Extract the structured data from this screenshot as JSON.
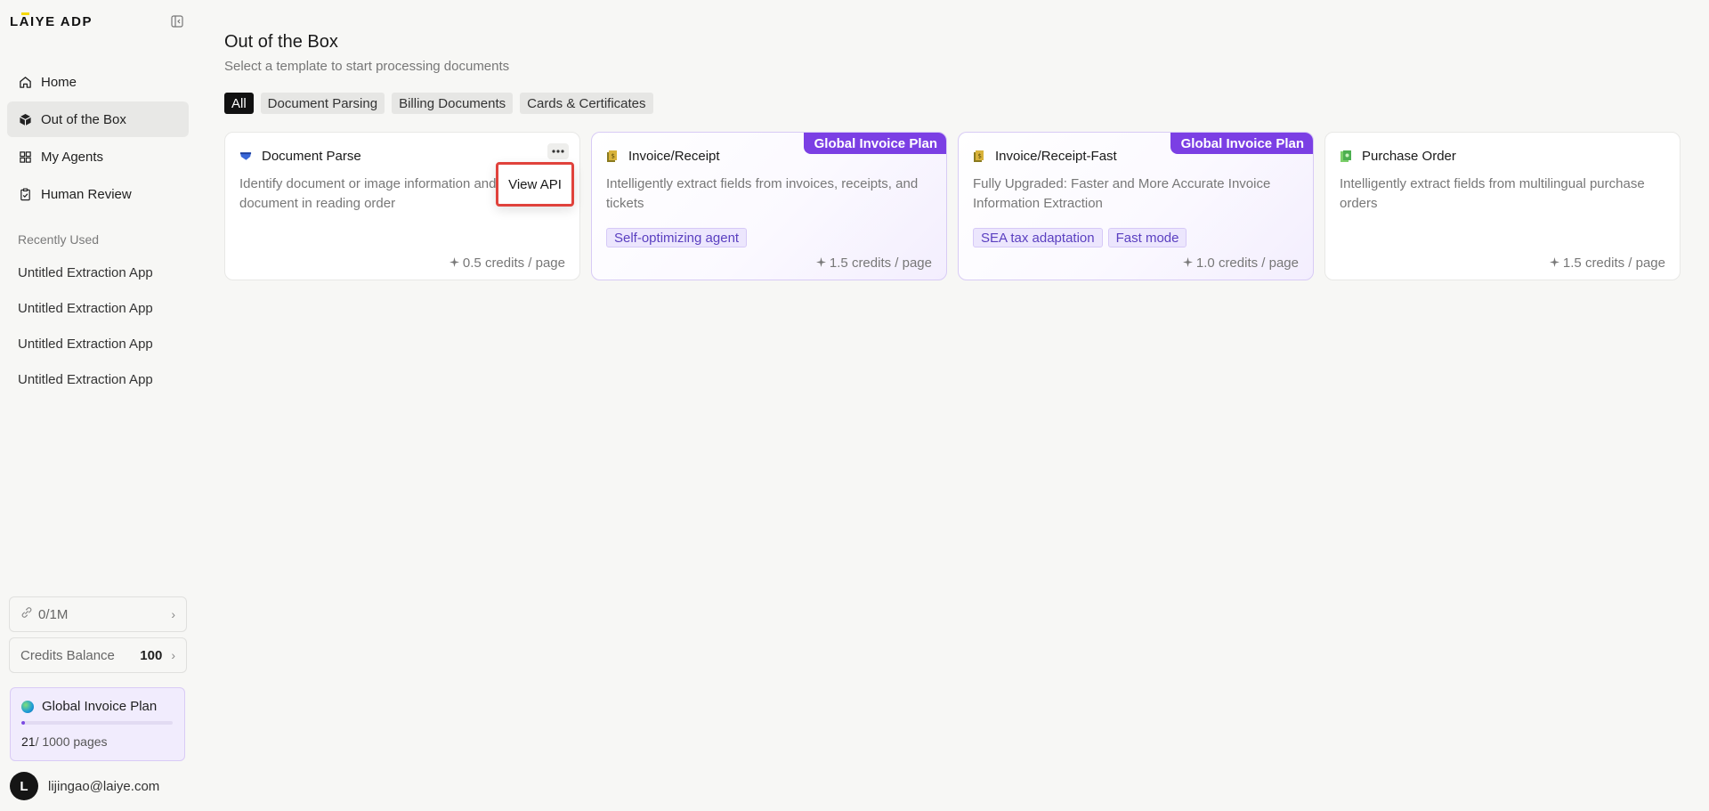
{
  "app": {
    "logo_text": "LAIYE ADP"
  },
  "sidebar": {
    "nav": [
      {
        "label": "Home",
        "icon": "home-icon"
      },
      {
        "label": "Out of the Box",
        "icon": "cube-icon",
        "active": true
      },
      {
        "label": "My Agents",
        "icon": "grid-icon"
      },
      {
        "label": "Human Review",
        "icon": "clipboard-check-icon"
      }
    ],
    "recent_title": "Recently Used",
    "recent": [
      "Untitled Extraction App",
      "Untitled Extraction App",
      "Untitled Extraction App",
      "Untitled Extraction App"
    ],
    "usage_label": "0/1M",
    "credits_label": "Credits Balance",
    "credits_value": "100",
    "plan": {
      "name": "Global Invoice Plan",
      "used": "21",
      "total_text": "/ 1000 pages",
      "progress_fraction": 0.021
    },
    "user": {
      "initial": "L",
      "email": "lijingao@laiye.com"
    }
  },
  "main": {
    "title": "Out of the Box",
    "subtitle": "Select a template to start processing documents",
    "filters": [
      {
        "label": "All",
        "active": true
      },
      {
        "label": "Document Parsing"
      },
      {
        "label": "Billing Documents"
      },
      {
        "label": "Cards & Certificates"
      }
    ],
    "cards": [
      {
        "title": "Document Parse",
        "description": "Identify document or image information and output the document in reading order",
        "tags": [],
        "credits": "0.5 credits / page",
        "ribbon": "",
        "icon": "document-parse-icon"
      },
      {
        "title": "Invoice/Receipt",
        "description": "Intelligently extract fields from invoices, receipts, and tickets",
        "tags": [
          "Self-optimizing agent"
        ],
        "credits": "1.5 credits / page",
        "ribbon": "Global Invoice Plan",
        "icon": "invoice-icon"
      },
      {
        "title": "Invoice/Receipt-Fast",
        "description": "Fully Upgraded: Faster and More Accurate Invoice Information Extraction",
        "tags": [
          "SEA tax adaptation",
          "Fast mode"
        ],
        "credits": "1.0 credits / page",
        "ribbon": "Global Invoice Plan",
        "icon": "invoice-fast-icon"
      },
      {
        "title": "Purchase Order",
        "description": "Intelligently extract fields from multilingual purchase orders",
        "tags": [],
        "credits": "1.5 credits / page",
        "ribbon": "",
        "icon": "purchase-order-icon"
      }
    ],
    "popup_menu": {
      "item": "View API"
    }
  },
  "colors": {
    "accent_purple": "#7b3fe4",
    "highlight_red": "#e0423c",
    "active_chip": "#111111"
  }
}
